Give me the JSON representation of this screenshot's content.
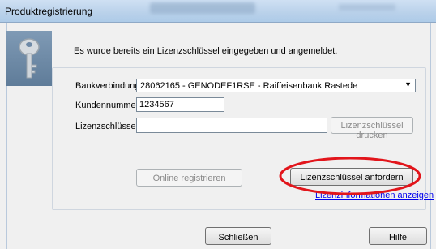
{
  "window": {
    "title": "Produktregistrierung"
  },
  "intro_text": "Es wurde bereits ein Lizenzschlüssel eingegeben und angemeldet.",
  "form": {
    "bank_label": "Bankverbindung",
    "bank_value": "28062165 - GENODEF1RSE - Raiffeisenbank Rastede",
    "customer_label": "Kundennummer",
    "customer_value": "1234567",
    "license_label": "Lizenzschlüssel",
    "license_value": ""
  },
  "buttons": {
    "print_license": "Lizenzschlüssel drucken",
    "register_online": "Online registrieren",
    "request_license": "Lizenzschlüssel anfordern",
    "close": "Schließen",
    "help": "Hilfe"
  },
  "link": {
    "info": "Lizenzinformationen anzeigen"
  },
  "annotation": {
    "color": "#e2151b"
  }
}
